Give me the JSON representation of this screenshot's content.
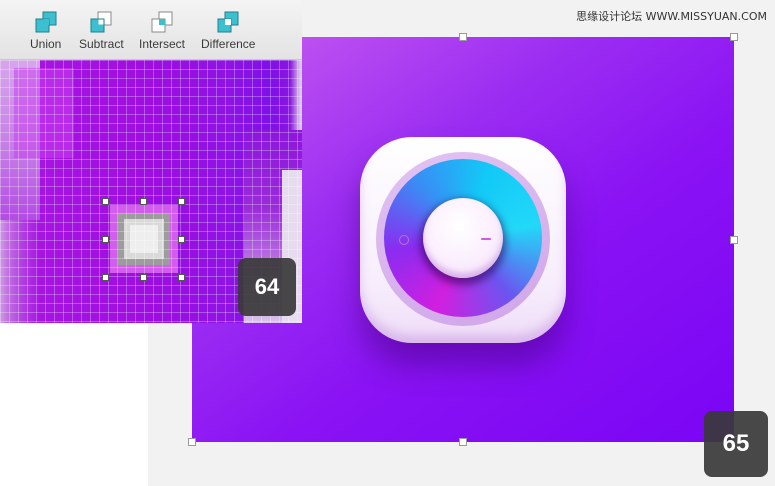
{
  "watermark": {
    "text": "思缘设计论坛 WWW.MISSYUAN.COM"
  },
  "toolbar": {
    "tools": [
      {
        "label": "Union",
        "icon": "union-icon"
      },
      {
        "label": "Subtract",
        "icon": "subtract-icon"
      },
      {
        "label": "Intersect",
        "icon": "intersect-icon"
      },
      {
        "label": "Difference",
        "icon": "difference-icon"
      }
    ]
  },
  "badges": {
    "zoom_step": "64",
    "canvas_step": "65"
  },
  "colors": {
    "accent_teal": "#2fb8c8",
    "artboard_start": "#c95ef0",
    "artboard_end": "#7a05f5",
    "ring_cyan": "#12c9f7",
    "ring_magenta": "#d11fe0"
  }
}
